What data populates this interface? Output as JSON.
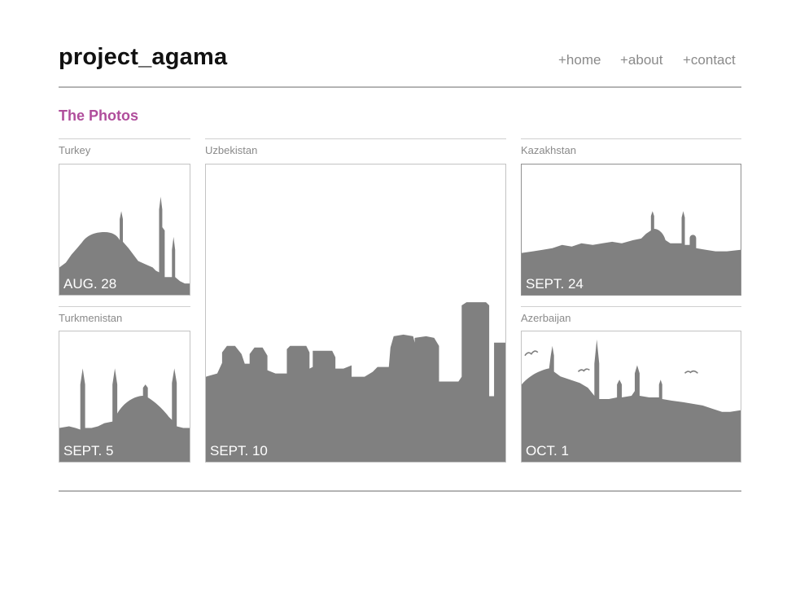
{
  "header": {
    "logo": "project_agama",
    "nav": [
      "+home",
      "+about",
      "+contact"
    ]
  },
  "section": {
    "title": "The Photos"
  },
  "photos": [
    {
      "country": "Turkey",
      "date": "AUG. 28"
    },
    {
      "country": "Uzbekistan",
      "date": "SEPT. 10"
    },
    {
      "country": "Kazakhstan",
      "date": "SEPT. 24"
    },
    {
      "country": "Turkmenistan",
      "date": "SEPT. 5"
    },
    {
      "country": "Azerbaijan",
      "date": "OCT. 1"
    }
  ],
  "colors": {
    "accent": "#b04e9c",
    "silhouette": "#808080",
    "rule": "#b4b4b4",
    "nav": "#8a8a8a"
  }
}
